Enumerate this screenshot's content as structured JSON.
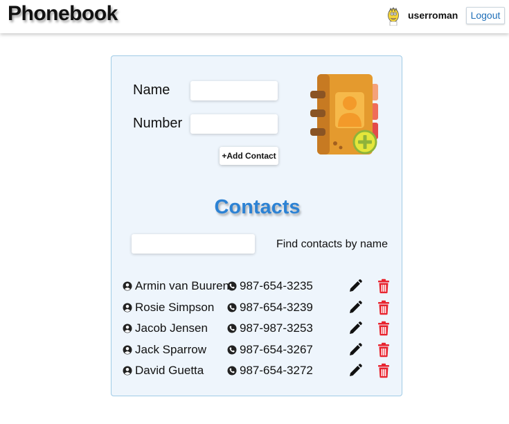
{
  "header": {
    "brand": "Phonebook",
    "username": "userroman",
    "logout_label": "Logout"
  },
  "form": {
    "name_label": "Name",
    "name_value": "",
    "number_label": "Number",
    "number_value": "",
    "add_button_label": "+Add Contact"
  },
  "contacts": {
    "title": "Contacts",
    "filter_value": "",
    "filter_label": "Find contacts by name",
    "items": [
      {
        "name": "Armin van Buuren",
        "phone": "987-654-3235"
      },
      {
        "name": "Rosie Simpson",
        "phone": "987-654-3239"
      },
      {
        "name": "Jacob Jensen",
        "phone": "987-987-3253"
      },
      {
        "name": "Jack Sparrow",
        "phone": "987-654-3267"
      },
      {
        "name": "David Guetta",
        "phone": "987-654-3272"
      }
    ]
  },
  "icons": {
    "user": "user-circle-icon",
    "phone": "phone-icon",
    "edit": "pencil-icon",
    "delete": "trash-icon",
    "book": "address-book-add-icon",
    "avatar": "user-avatar"
  },
  "colors": {
    "accent": "#2c82d4",
    "delete": "#e8232e",
    "card_bg": "#eef5fc",
    "card_border": "#9fcbe6"
  }
}
